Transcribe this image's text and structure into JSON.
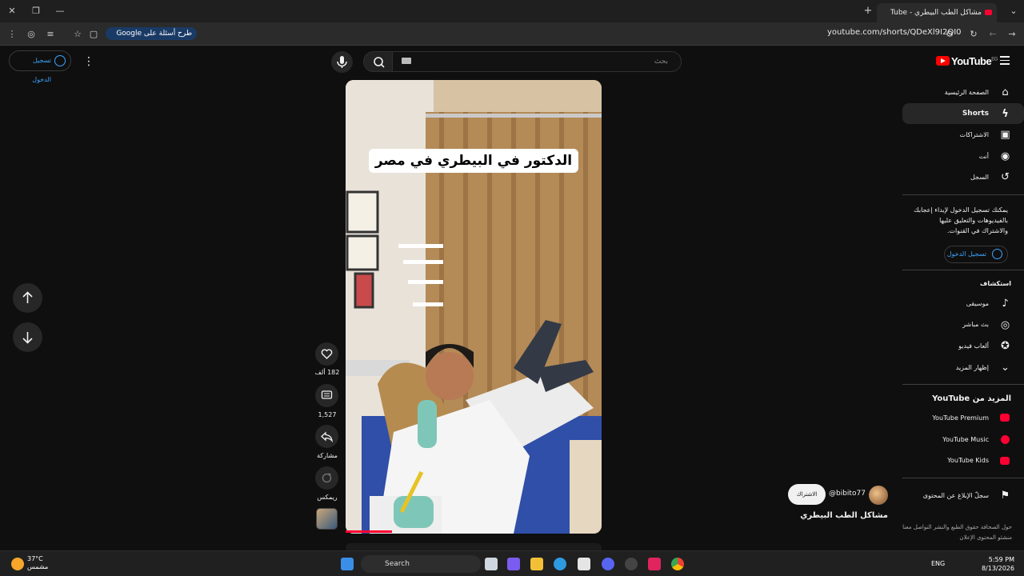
{
  "browser": {
    "tab_title": "مشاكل الطب البيطري - Tube",
    "google_pill": "طرح أسئلة على Google",
    "url": "youtube.com/shorts/QDeXl9I2QI0"
  },
  "masthead": {
    "search_placeholder": "بحث",
    "signin_label": "تسجيل الدخول",
    "logo_text": "YouTube",
    "logo_country": "EG"
  },
  "sidebar": {
    "items": [
      {
        "label": "الصفحة الرئيسية",
        "icon": "home-icon"
      },
      {
        "label": "Shorts",
        "icon": "shorts-icon",
        "active": true
      },
      {
        "label": "الاشتراكات",
        "icon": "subscriptions-icon"
      },
      {
        "label": "أنت",
        "icon": "you-icon"
      },
      {
        "label": "السجل",
        "icon": "history-icon"
      }
    ],
    "signin_prompt": "يمكنك تسجيل الدخول لإبداء إعجابك بالفيديوهات والتعليق عليها والاشتراك في القنوات.",
    "signin_label": "تسجيل الدخول",
    "explore_header": "استكشاف",
    "explore_items": [
      {
        "label": "موسيقى",
        "icon": "music-icon"
      },
      {
        "label": "بث مباشر",
        "icon": "live-icon"
      },
      {
        "label": "ألعاب فيديو",
        "icon": "gaming-icon"
      },
      {
        "label": "إظهار المزيد",
        "icon": "chevron-down-icon"
      }
    ],
    "more_header_prefix": "المزيد من",
    "more_header_brand": "YouTube",
    "more_items": [
      {
        "label": "YouTube Premium"
      },
      {
        "label": "YouTube Music"
      },
      {
        "label": "YouTube Kids"
      }
    ],
    "report_label": "سجلّ الإبلاغ عن المحتوى",
    "footer_links": "حول الصحافة حقوق الطبع والنشر التواصل معنا منشئو المحتوى الإعلان"
  },
  "short": {
    "caption": "الدكتور في البيطري في مصر",
    "likes": "182 ألف",
    "comments": "1,527",
    "share": "مشاركة",
    "remix": "ريمكس",
    "channel_handle": "@bibito77",
    "subscribe": "الاشتراك",
    "title": "مشاكل الطب البيطري",
    "progress": 0.18
  },
  "taskbar": {
    "temperature": "37°C",
    "weather_desc": "مشمس",
    "search": "Search",
    "lang": "ENG",
    "time": "5:59 PM",
    "date": "8/13/2026"
  },
  "colors": {
    "accent_blue": "#3ea6ff",
    "brand_red": "#ff0000",
    "background": "#0f0f0f"
  }
}
